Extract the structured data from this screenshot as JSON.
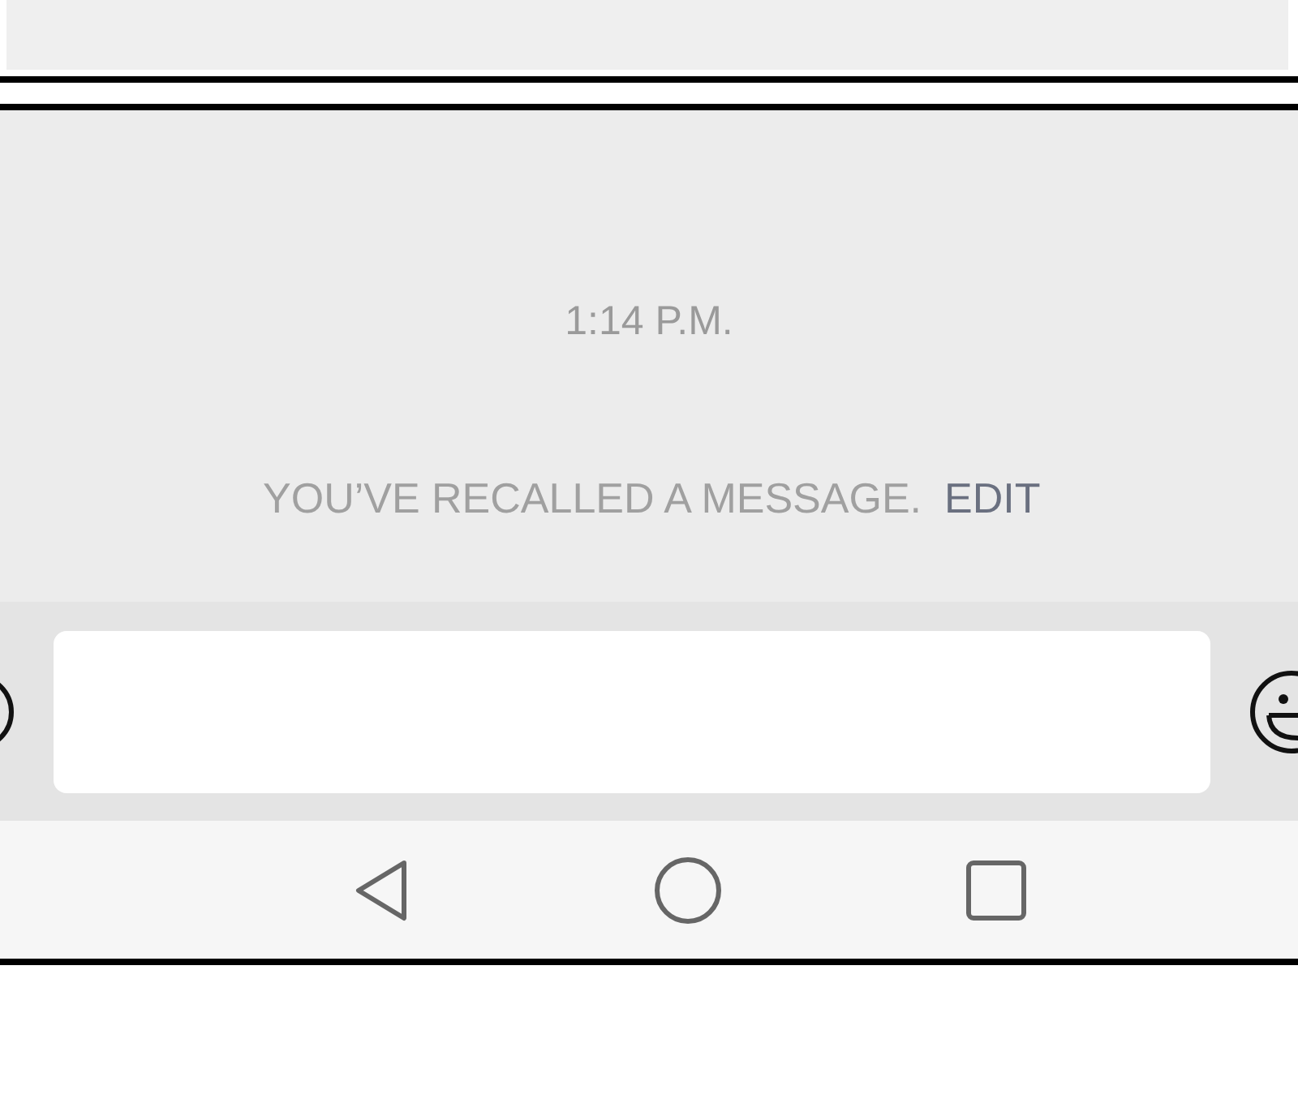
{
  "chat": {
    "timestamp": "1:14 P.M.",
    "notice": {
      "text": "YOU’VE RECALLED A MESSAGE.",
      "action": "EDIT"
    }
  }
}
